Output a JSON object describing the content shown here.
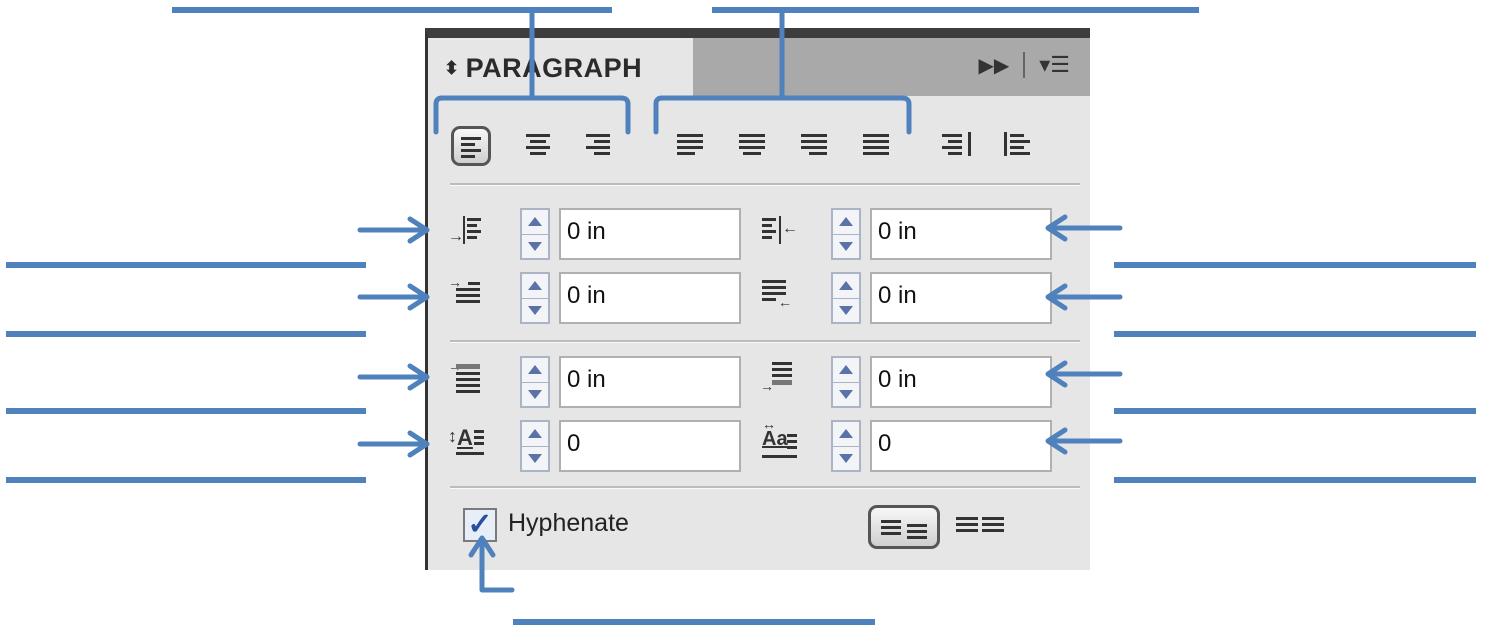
{
  "panel": {
    "tab_title": "PARAGRAPH",
    "tab_arrows_icon": "updown-arrows-icon",
    "expand_icon": "double-chevron-right-icon",
    "menu_icon": "panel-menu-icon"
  },
  "alignment": {
    "group1": [
      "align-left-icon",
      "align-center-icon",
      "align-right-icon"
    ],
    "group2": [
      "justify-last-left-icon",
      "justify-last-center-icon",
      "justify-last-right-icon",
      "justify-all-icon"
    ],
    "group3": [
      "align-towards-spine-icon",
      "align-away-from-spine-icon"
    ],
    "selected": "align-left-icon"
  },
  "fields": {
    "left_indent": "0 in",
    "right_indent": "0 in",
    "first_line_indent": "0 in",
    "last_line_right_indent": "0 in",
    "space_before": "0 in",
    "space_after": "0 in",
    "drop_cap_lines": "0",
    "drop_cap_characters": "0"
  },
  "hyphenate": {
    "label": "Hyphenate",
    "checked": true
  },
  "composer": {
    "options": [
      "single-line-composer-icon",
      "every-line-composer-icon"
    ],
    "selected": "single-line-composer-icon"
  },
  "colors": {
    "annotation": "#4f81bd",
    "panel_bg": "#e6e6e6",
    "tab_strip": "#a9a9a9"
  }
}
